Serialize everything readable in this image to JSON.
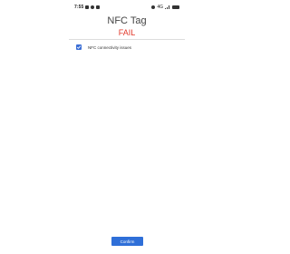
{
  "status_bar": {
    "time": "7:55",
    "network": "4G"
  },
  "header": {
    "title": "NFC Tag",
    "result": "FAIL"
  },
  "checks": [
    {
      "label": "NFC connectivity issues",
      "checked": true
    }
  ],
  "footer": {
    "confirm_label": "Confirm"
  },
  "colors": {
    "fail": "#e2382a",
    "accent": "#2f6fd8"
  },
  "icons": {
    "checkbox": "check-icon",
    "status": [
      "notification-icon",
      "signal-icon",
      "battery-icon"
    ]
  }
}
